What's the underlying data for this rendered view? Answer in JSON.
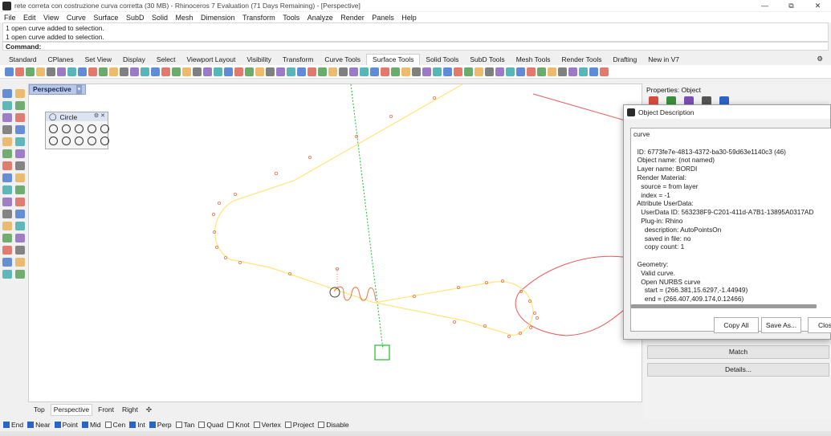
{
  "window": {
    "title": "rete correta con costruzione curva corretta (30 MB) - Rhinoceros 7 Evaluation (71 Days Remaining) - [Perspective]",
    "controls": [
      "—",
      "⧉",
      "✕"
    ]
  },
  "menu": [
    "File",
    "Edit",
    "View",
    "Curve",
    "Surface",
    "SubD",
    "Solid",
    "Mesh",
    "Dimension",
    "Transform",
    "Tools",
    "Analyze",
    "Render",
    "Panels",
    "Help"
  ],
  "command_history": [
    "1 open curve added to selection.",
    "1 open curve added to selection."
  ],
  "command_prompt": "Command:",
  "toolbar_tabs": [
    "Standard",
    "CPlanes",
    "Set View",
    "Display",
    "Select",
    "Viewport Layout",
    "Visibility",
    "Transform",
    "Curve Tools",
    "Surface Tools",
    "Solid Tools",
    "SubD Tools",
    "Mesh Tools",
    "Render Tools",
    "Drafting",
    "New in V7"
  ],
  "active_toolbar_tab": "Surface Tools",
  "viewport": {
    "active_name": "Perspective",
    "dropdown": "▾",
    "tabs": [
      "Top",
      "Perspective",
      "Front",
      "Right"
    ],
    "add_tab": "✣"
  },
  "circle_panel": {
    "title": "Circle",
    "controls": "⚙ ✕"
  },
  "osnaps": [
    {
      "label": "End",
      "checked": true
    },
    {
      "label": "Near",
      "checked": true
    },
    {
      "label": "Point",
      "checked": true
    },
    {
      "label": "Mid",
      "checked": true
    },
    {
      "label": "Cen",
      "checked": false
    },
    {
      "label": "Int",
      "checked": true
    },
    {
      "label": "Perp",
      "checked": true
    },
    {
      "label": "Tan",
      "checked": false
    },
    {
      "label": "Quad",
      "checked": false
    },
    {
      "label": "Knot",
      "checked": false
    },
    {
      "label": "Vertex",
      "checked": false
    },
    {
      "label": "Project",
      "checked": false
    },
    {
      "label": "Disable",
      "checked": false
    }
  ],
  "properties": {
    "title": "Properties: Object",
    "match_label": "Match",
    "details_label": "Details..."
  },
  "dialog": {
    "title": "Object Description",
    "text": "curve\n\n  ID: 6773fe7e-4813-4372-ba30-59d63e1140c3 (46)\n  Object name: (not named)\n  Layer name: BORDI\n  Render Material:\n    source = from layer\n    index = -1\n  Attribute UserData:\n    UserData ID: 563238F9-C201-411d-A7B1-13895A0317AD\n    Plug-in: Rhino\n      description: AutoPointsOn\n      saved in file: no\n      copy count: 1\n\n  Geometry:\n    Valid curve.\n    Open NURBS curve\n      start = (266.381,15.6297,-1.44949)\n      end = (266.407,409.174,0.12466)",
    "copy_all": "Copy All",
    "save_as": "Save As...",
    "close": "Close"
  },
  "colors": {
    "curve_yellow": "#ffe57a",
    "control_point": "#e8734a",
    "red_curve": "#e85a5a",
    "green_axis": "#22bb33",
    "viewport_tab": "#b9c8e8"
  }
}
